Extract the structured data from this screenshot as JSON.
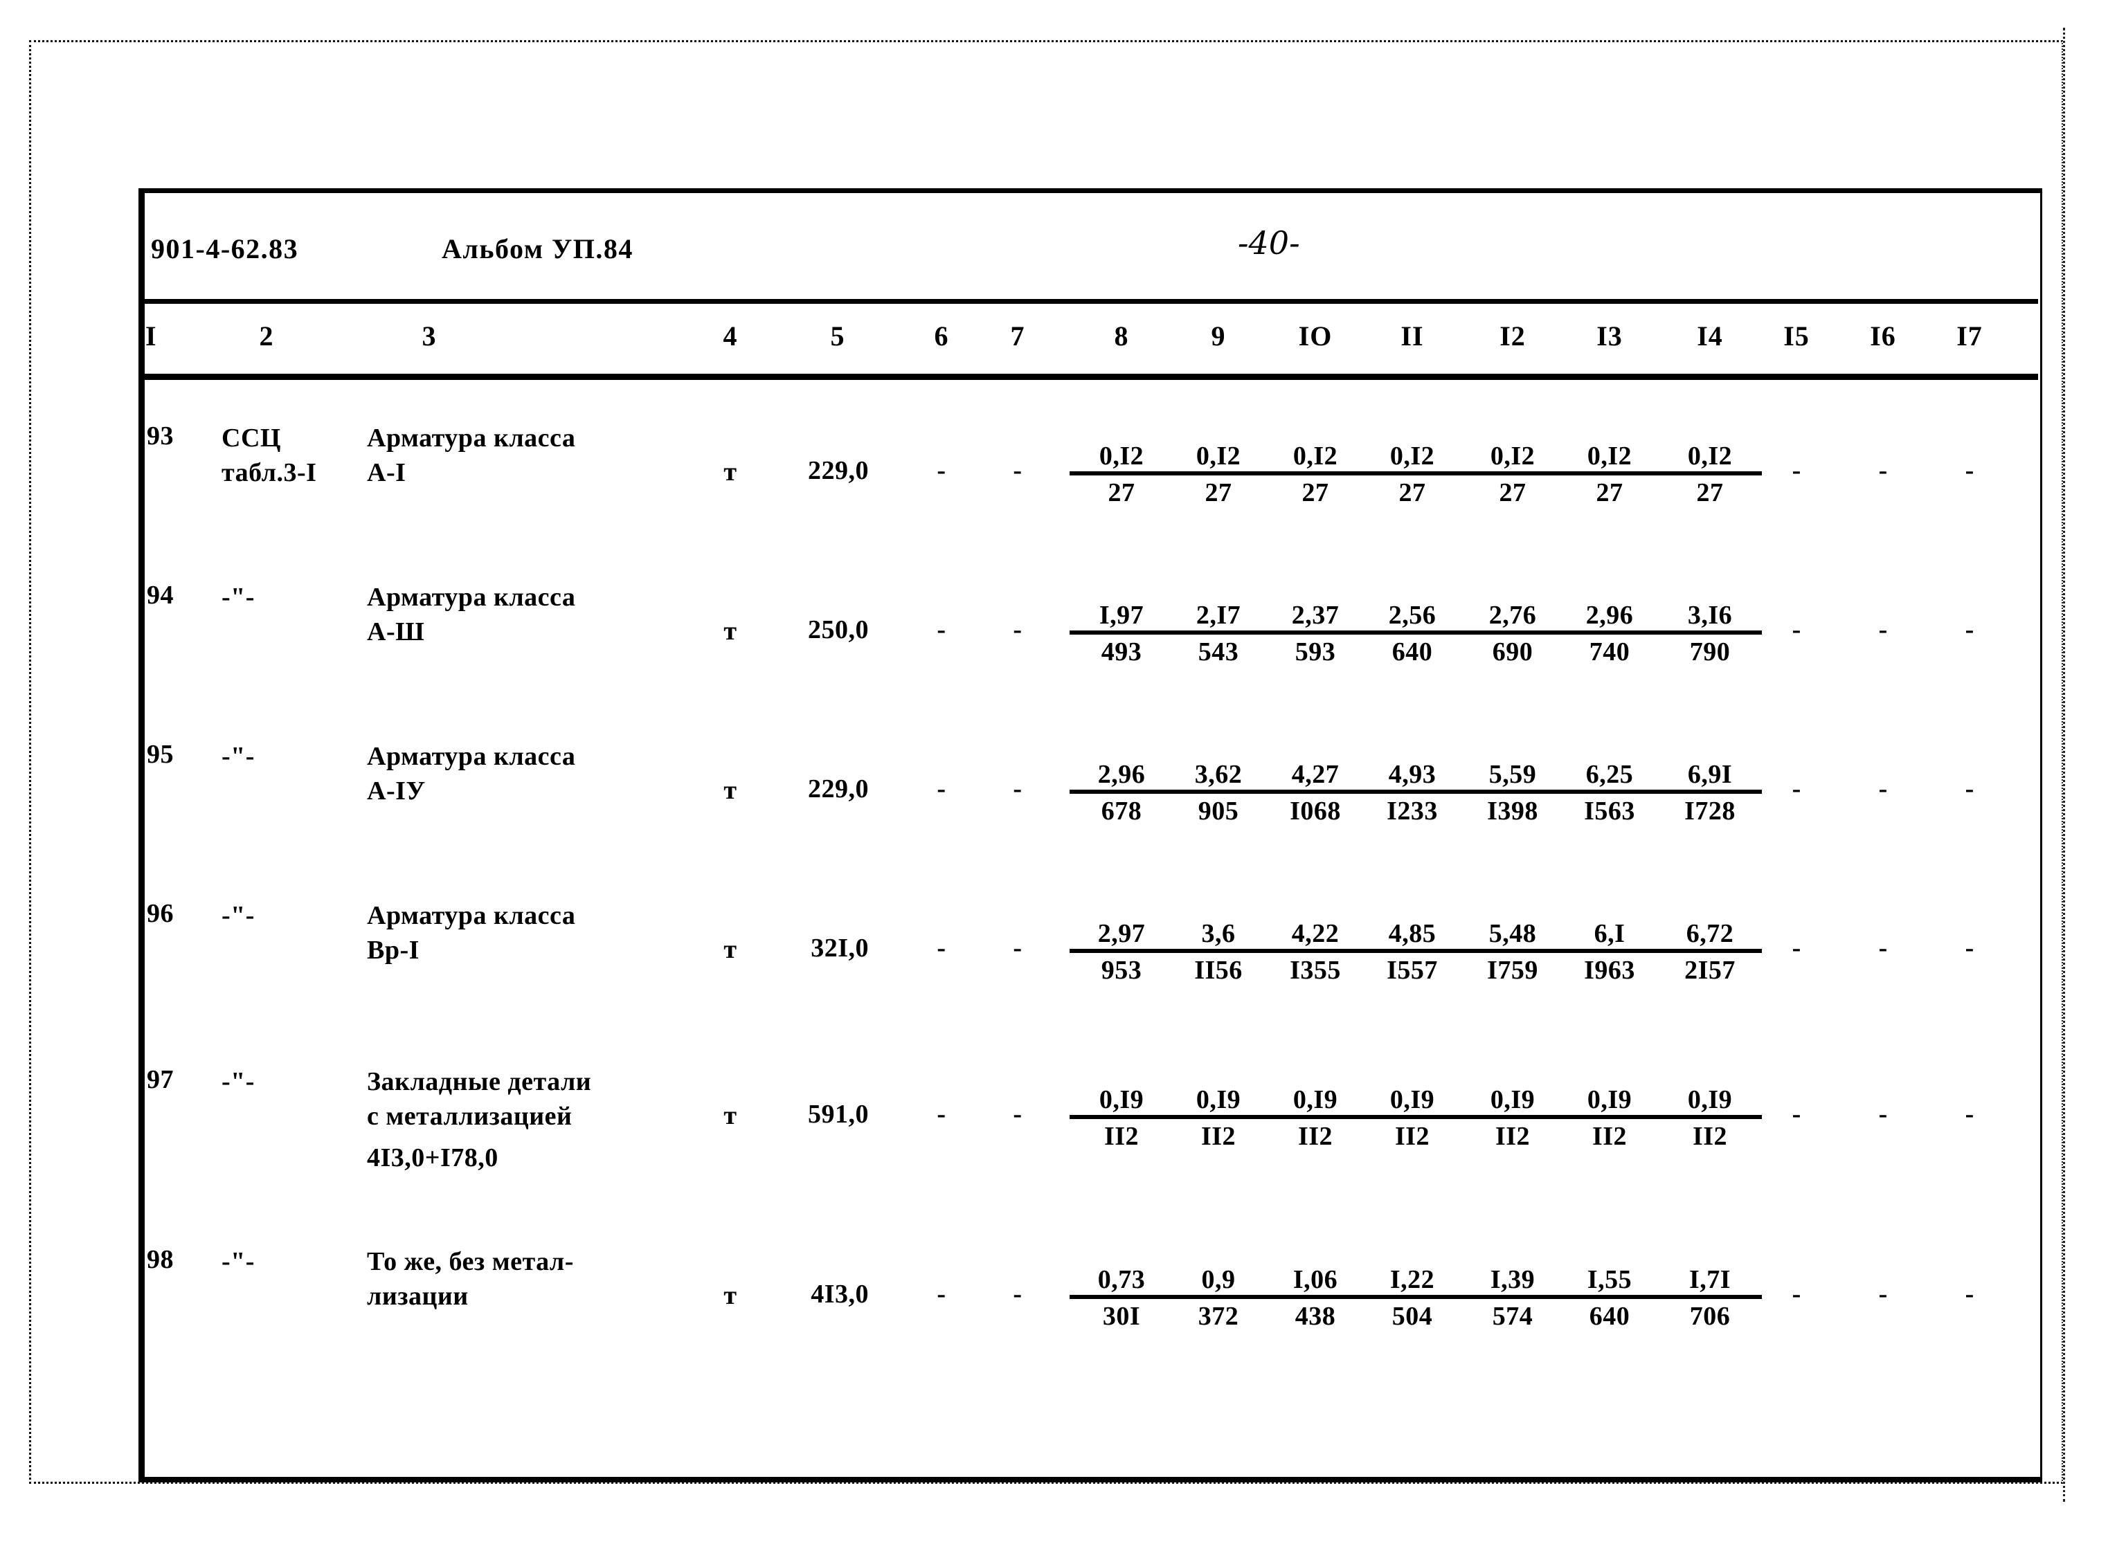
{
  "page": {
    "doc_code": "901-4-62.83",
    "album": "Альбом УП.84",
    "page_number": "-40-"
  },
  "table": {
    "column_numbers": [
      "I",
      "2",
      "3",
      "4",
      "5",
      "6",
      "7",
      "8",
      "9",
      "IO",
      "II",
      "I2",
      "I3",
      "I4",
      "I5",
      "I6",
      "I7"
    ],
    "ditto_mark": "-\"-",
    "dash": "-",
    "rows": [
      {
        "num": "93",
        "source_line1": "ССЦ",
        "source_line2": "табл.3-I",
        "desc_line1": "Арматура класса",
        "desc_line2": "А-I",
        "desc_line3": "",
        "unit": "т",
        "qty": "229,0",
        "col6": "-",
        "col7": "-",
        "fractions": [
          {
            "top": "0,I2",
            "bot": "27"
          },
          {
            "top": "0,I2",
            "bot": "27"
          },
          {
            "top": "0,I2",
            "bot": "27"
          },
          {
            "top": "0,I2",
            "bot": "27"
          },
          {
            "top": "0,I2",
            "bot": "27"
          },
          {
            "top": "0,I2",
            "bot": "27"
          },
          {
            "top": "0,I2",
            "bot": "27"
          }
        ],
        "tail": [
          "-",
          "-",
          "-"
        ]
      },
      {
        "num": "94",
        "source_line1": "-\"-",
        "source_line2": "",
        "desc_line1": "Арматура класса",
        "desc_line2": "А-Ш",
        "desc_line3": "",
        "unit": "т",
        "qty": "250,0",
        "col6": "-",
        "col7": "-",
        "fractions": [
          {
            "top": "I,97",
            "bot": "493"
          },
          {
            "top": "2,I7",
            "bot": "543"
          },
          {
            "top": "2,37",
            "bot": "593"
          },
          {
            "top": "2,56",
            "bot": "640"
          },
          {
            "top": "2,76",
            "bot": "690"
          },
          {
            "top": "2,96",
            "bot": "740"
          },
          {
            "top": "3,I6",
            "bot": "790"
          }
        ],
        "tail": [
          "-",
          "-",
          "-"
        ]
      },
      {
        "num": "95",
        "source_line1": "-\"-",
        "source_line2": "",
        "desc_line1": "Арматура класса",
        "desc_line2": "А-IУ",
        "desc_line3": "",
        "unit": "т",
        "qty": "229,0",
        "col6": "-",
        "col7": "-",
        "fractions": [
          {
            "top": "2,96",
            "bot": "678"
          },
          {
            "top": "3,62",
            "bot": "905"
          },
          {
            "top": "4,27",
            "bot": "I068"
          },
          {
            "top": "4,93",
            "bot": "I233"
          },
          {
            "top": "5,59",
            "bot": "I398"
          },
          {
            "top": "6,25",
            "bot": "I563"
          },
          {
            "top": "6,9I",
            "bot": "I728"
          }
        ],
        "tail": [
          "-",
          "-",
          "-"
        ]
      },
      {
        "num": "96",
        "source_line1": "-\"-",
        "source_line2": "",
        "desc_line1": "Арматура класса",
        "desc_line2": "Вр-I",
        "desc_line3": "",
        "unit": "т",
        "qty": "32I,0",
        "col6": "-",
        "col7": "-",
        "fractions": [
          {
            "top": "2,97",
            "bot": "953"
          },
          {
            "top": "3,6",
            "bot": "II56"
          },
          {
            "top": "4,22",
            "bot": "I355"
          },
          {
            "top": "4,85",
            "bot": "I557"
          },
          {
            "top": "5,48",
            "bot": "I759"
          },
          {
            "top": "6,I",
            "bot": "I963"
          },
          {
            "top": "6,72",
            "bot": "2I57"
          }
        ],
        "tail": [
          "-",
          "-",
          "-"
        ]
      },
      {
        "num": "97",
        "source_line1": "-\"-",
        "source_line2": "",
        "desc_line1": "Закладные детали",
        "desc_line2": "с металлизацией",
        "desc_line3": "4I3,0+I78,0",
        "unit": "т",
        "qty": "591,0",
        "col6": "-",
        "col7": "-",
        "fractions": [
          {
            "top": "0,I9",
            "bot": "II2"
          },
          {
            "top": "0,I9",
            "bot": "II2"
          },
          {
            "top": "0,I9",
            "bot": "II2"
          },
          {
            "top": "0,I9",
            "bot": "II2"
          },
          {
            "top": "0,I9",
            "bot": "II2"
          },
          {
            "top": "0,I9",
            "bot": "II2"
          },
          {
            "top": "0,I9",
            "bot": "II2"
          }
        ],
        "tail": [
          "-",
          "-",
          "-"
        ]
      },
      {
        "num": "98",
        "source_line1": "-\"-",
        "source_line2": "",
        "desc_line1": "То же, без метал-",
        "desc_line2": "лизации",
        "desc_line3": "",
        "unit": "т",
        "qty": "4I3,0",
        "col6": "-",
        "col7": "-",
        "fractions": [
          {
            "top": "0,73",
            "bot": "30I"
          },
          {
            "top": "0,9",
            "bot": "372"
          },
          {
            "top": "I,06",
            "bot": "438"
          },
          {
            "top": "I,22",
            "bot": "504"
          },
          {
            "top": "I,39",
            "bot": "574"
          },
          {
            "top": "I,55",
            "bot": "640"
          },
          {
            "top": "I,7I",
            "bot": "706"
          }
        ],
        "tail": [
          "-",
          "-",
          "-"
        ]
      }
    ]
  }
}
